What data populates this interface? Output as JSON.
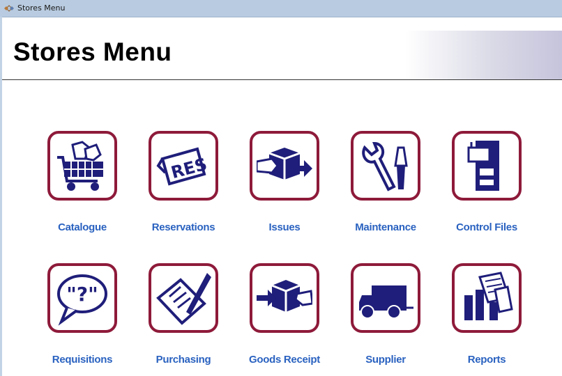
{
  "window": {
    "title": "Stores Menu",
    "icon": "stores-diamond-icon"
  },
  "header": {
    "title": "Stores Menu"
  },
  "colors": {
    "tile_border": "#8e1a3a",
    "icon": "#1f1e7a",
    "label": "#2a62c0"
  },
  "menu": [
    {
      "label": "Catalogue",
      "icon": "shopping-cart-icon"
    },
    {
      "label": "Reservations",
      "icon": "res-ticket-icon"
    },
    {
      "label": "Issues",
      "icon": "box-hand-out-icon"
    },
    {
      "label": "Maintenance",
      "icon": "wrench-screwdriver-icon"
    },
    {
      "label": "Control Files",
      "icon": "file-cabinet-icon"
    },
    {
      "label": "Requisitions",
      "icon": "speech-bubble-question-icon"
    },
    {
      "label": "Purchasing",
      "icon": "form-pen-icon"
    },
    {
      "label": "Goods Receipt",
      "icon": "box-hand-in-icon"
    },
    {
      "label": "Supplier",
      "icon": "delivery-truck-icon"
    },
    {
      "label": "Reports",
      "icon": "reports-documents-icon"
    }
  ],
  "res_text": "RES",
  "req_text": "\"?\""
}
